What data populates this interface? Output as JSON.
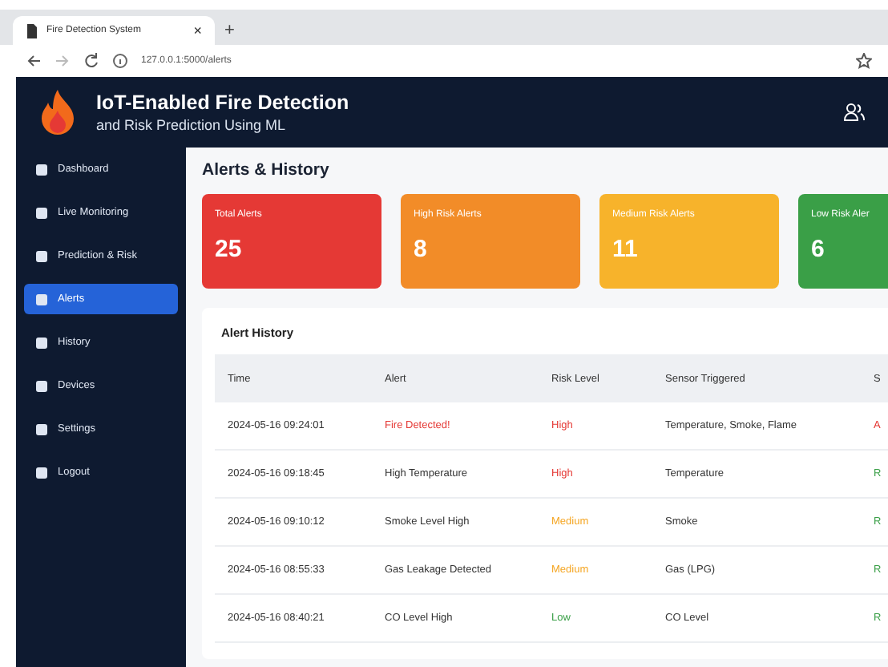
{
  "browser": {
    "tab_title": "Fire Detection System",
    "tab_close": "×",
    "new_tab": "+",
    "url": "127.0.0.1:5000/alerts"
  },
  "header": {
    "title": "IoT-Enabled Fire Detection",
    "subtitle": "and Risk Prediction Using ML"
  },
  "sidebar": {
    "items": [
      {
        "label": "Dashboard",
        "selected": false
      },
      {
        "label": "Live Monitoring",
        "selected": false
      },
      {
        "label": "Prediction & Risk",
        "selected": false
      },
      {
        "label": "Alerts",
        "selected": true
      },
      {
        "label": "History",
        "selected": false
      },
      {
        "label": "Devices",
        "selected": false
      },
      {
        "label": "Settings",
        "selected": false
      },
      {
        "label": "Logout",
        "selected": false
      }
    ]
  },
  "page_title": "Alerts & History",
  "stat_cards": [
    {
      "label": "Total Alerts",
      "value": "25",
      "color": "#e53935"
    },
    {
      "label": "High Risk Alerts",
      "value": "8",
      "color": "#f28c28"
    },
    {
      "label": "Medium Risk Alerts",
      "value": "11",
      "color": "#f7b32b"
    },
    {
      "label": "Low Risk Aler",
      "value": "6",
      "color": "#3a9f47"
    }
  ],
  "table": {
    "title": "Alert History",
    "columns": [
      "Time",
      "Alert",
      "Risk Level",
      "Sensor Triggered",
      "S"
    ],
    "rows": [
      {
        "time": "2024-05-16 09:24:01",
        "alert": "Fire Detected!",
        "alert_alarm": true,
        "risk": {
          "text": "High",
          "color": "#e53935"
        },
        "sensor": "Temperature, Smoke, Flame",
        "status": {
          "text": "A",
          "color": "#e53935"
        }
      },
      {
        "time": "2024-05-16 09:18:45",
        "alert": "High Temperature",
        "alert_alarm": false,
        "risk": {
          "text": "High",
          "color": "#e53935"
        },
        "sensor": "Temperature",
        "status": {
          "text": "R",
          "color": "#3a9f47"
        }
      },
      {
        "time": "2024-05-16 09:10:12",
        "alert": "Smoke Level High",
        "alert_alarm": false,
        "risk": {
          "text": "Medium",
          "color": "#f5a623"
        },
        "sensor": "Smoke",
        "status": {
          "text": "R",
          "color": "#3a9f47"
        }
      },
      {
        "time": "2024-05-16 08:55:33",
        "alert": "Gas Leakage Detected",
        "alert_alarm": false,
        "risk": {
          "text": "Medium",
          "color": "#f5a623"
        },
        "sensor": "Gas (LPG)",
        "status": {
          "text": "R",
          "color": "#3a9f47"
        }
      },
      {
        "time": "2024-05-16 08:40:21",
        "alert": "CO Level High",
        "alert_alarm": false,
        "risk": {
          "text": "Low",
          "color": "#3a9f47"
        },
        "sensor": "CO Level",
        "status": {
          "text": "R",
          "color": "#3a9f47"
        }
      }
    ]
  }
}
